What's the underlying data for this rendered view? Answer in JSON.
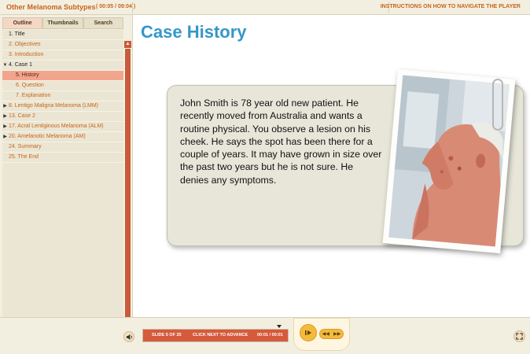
{
  "header": {
    "course_title": "Other Melanoma Subtypes",
    "time": "( 00:05 / 09:04 )",
    "instructions_link": "INSTRUCTIONS ON HOW TO NAVIGATE THE PLAYER"
  },
  "sidebar": {
    "tabs": [
      {
        "label": "Outline",
        "active": true
      },
      {
        "label": "Thumbnails",
        "active": false
      },
      {
        "label": "Search",
        "active": false
      }
    ],
    "items": [
      {
        "label": "1. Title",
        "level": 0,
        "color": "dark",
        "arrow": ""
      },
      {
        "label": "2. Objectives",
        "level": 0,
        "color": "orange",
        "arrow": ""
      },
      {
        "label": "3. Introduction",
        "level": 0,
        "color": "orange",
        "arrow": ""
      },
      {
        "label": "4. Case 1",
        "level": 0,
        "color": "dark",
        "arrow": "▼"
      },
      {
        "label": "5. History",
        "level": 1,
        "color": "selected",
        "arrow": ""
      },
      {
        "label": "6. Question",
        "level": 1,
        "color": "orange",
        "arrow": ""
      },
      {
        "label": "7. Explanation",
        "level": 1,
        "color": "orange",
        "arrow": ""
      },
      {
        "label": "8. Lentigo Maligna Melanoma (LMM)",
        "level": 0,
        "color": "orange",
        "arrow": "▶"
      },
      {
        "label": "13. Case 2",
        "level": 0,
        "color": "orange",
        "arrow": "▶"
      },
      {
        "label": "17. Acral Lentiginous Melanoma (ALM)",
        "level": 0,
        "color": "orange",
        "arrow": "▶"
      },
      {
        "label": "20. Amelanotic Melanoma (AM)",
        "level": 0,
        "color": "orange",
        "arrow": "▶"
      },
      {
        "label": "24. Summary",
        "level": 0,
        "color": "orange",
        "arrow": ""
      },
      {
        "label": "25. The End",
        "level": 0,
        "color": "orange",
        "arrow": ""
      }
    ],
    "scroll_up_icon": "▲",
    "scroll_down_icon": "▼"
  },
  "main": {
    "title": "Case History",
    "case_text": "John Smith is 78 year old new patient.  He recently moved from Australia and wants a routine physical.  You observe a lesion on his cheek.  He says the spot has been there for a couple of years.  It may have grown in size over the past two years but he is not sure.  He denies any symptoms."
  },
  "player": {
    "slide_label": "SLIDE 5 OF 25",
    "advance_label": "CLICK NEXT TO ADVANCE",
    "slide_time": "00:01 / 00:01",
    "progress": 1.0,
    "play_icon": "❙▶",
    "prev_icon": "◀◀",
    "next_icon": "▶▶",
    "volume_icon": "speaker-icon",
    "fullscreen_icon": "fullscreen-icon"
  },
  "colors": {
    "accent": "#c8641c",
    "title_blue": "#3597c8",
    "selected_row": "#f2a58d",
    "progress_fill": "#d65a3c"
  }
}
